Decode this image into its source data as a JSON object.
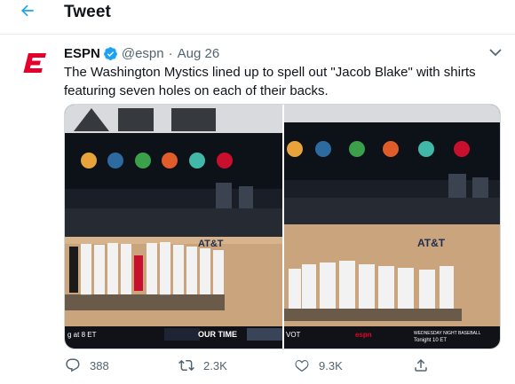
{
  "header": {
    "title": "Tweet",
    "back_icon": "arrow-left-icon"
  },
  "tweet": {
    "author_name": "ESPN",
    "handle": "@espn",
    "separator": "·",
    "date": "Aug 26",
    "verified": true,
    "avatar_icon": "espn-logo-icon",
    "text": "The Washington Mystics lined up to spell out \"Jacob Blake\" with shirts featuring seven holes on each of their backs."
  },
  "media": {
    "left_photo_scoreboard": "g at 8 ET",
    "left_photo_banner": "OUR TIME",
    "right_photo_scoreboard": "VOT",
    "court_sponsor": "AT&T",
    "right_photo_promo_line1": "WEDNESDAY NIGHT BASEBALL",
    "right_photo_promo_line2": "Tonight 10 ET",
    "right_photo_network": "espn"
  },
  "actions": {
    "reply_count": "388",
    "retweet_count": "2.3K",
    "like_count": "9.3K"
  },
  "colors": {
    "accent": "#1da1f2",
    "espn_red": "#e4002b",
    "text_secondary": "#536471",
    "divider": "#e6ecf0"
  }
}
